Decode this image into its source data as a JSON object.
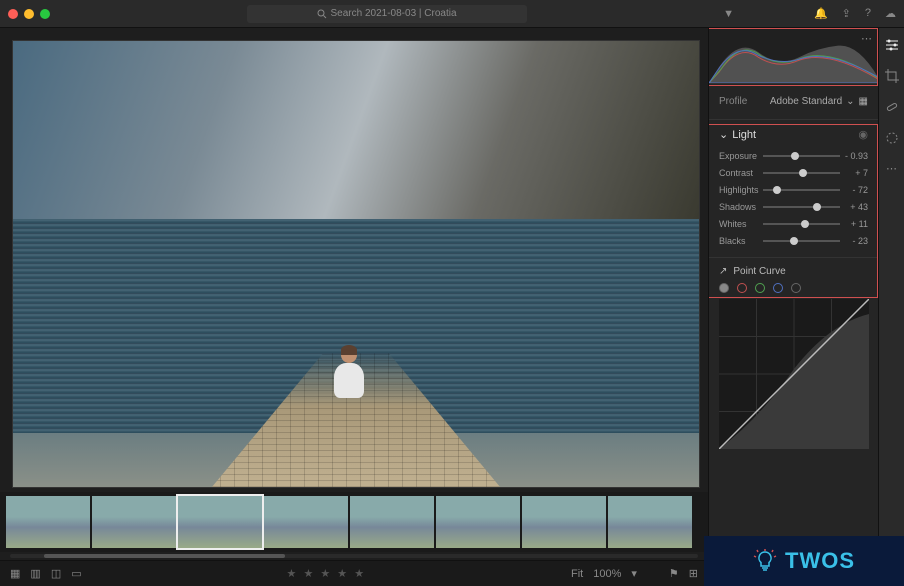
{
  "titlebar": {
    "search_text": "Search 2021-08-03 | Croatia"
  },
  "profile": {
    "label": "Profile",
    "value": "Adobe Standard"
  },
  "panel_light": {
    "title": "Light",
    "sliders": [
      {
        "name": "Exposure",
        "value": "- 0.93",
        "pos": 42
      },
      {
        "name": "Contrast",
        "value": "+ 7",
        "pos": 52
      },
      {
        "name": "Highlights",
        "value": "- 72",
        "pos": 18
      },
      {
        "name": "Shadows",
        "value": "+ 43",
        "pos": 70
      },
      {
        "name": "Whites",
        "value": "+ 11",
        "pos": 55
      },
      {
        "name": "Blacks",
        "value": "- 23",
        "pos": 40
      }
    ]
  },
  "point_curve": {
    "label": "Point Curve"
  },
  "bottom": {
    "fit_label": "Fit",
    "zoom": "100%"
  },
  "watermark": {
    "text": "TWOS"
  },
  "filmstrip": {
    "count": 8,
    "selected_index": 2
  },
  "colors": {
    "highlight": "#d05050",
    "accent": "#3ac0e8"
  }
}
